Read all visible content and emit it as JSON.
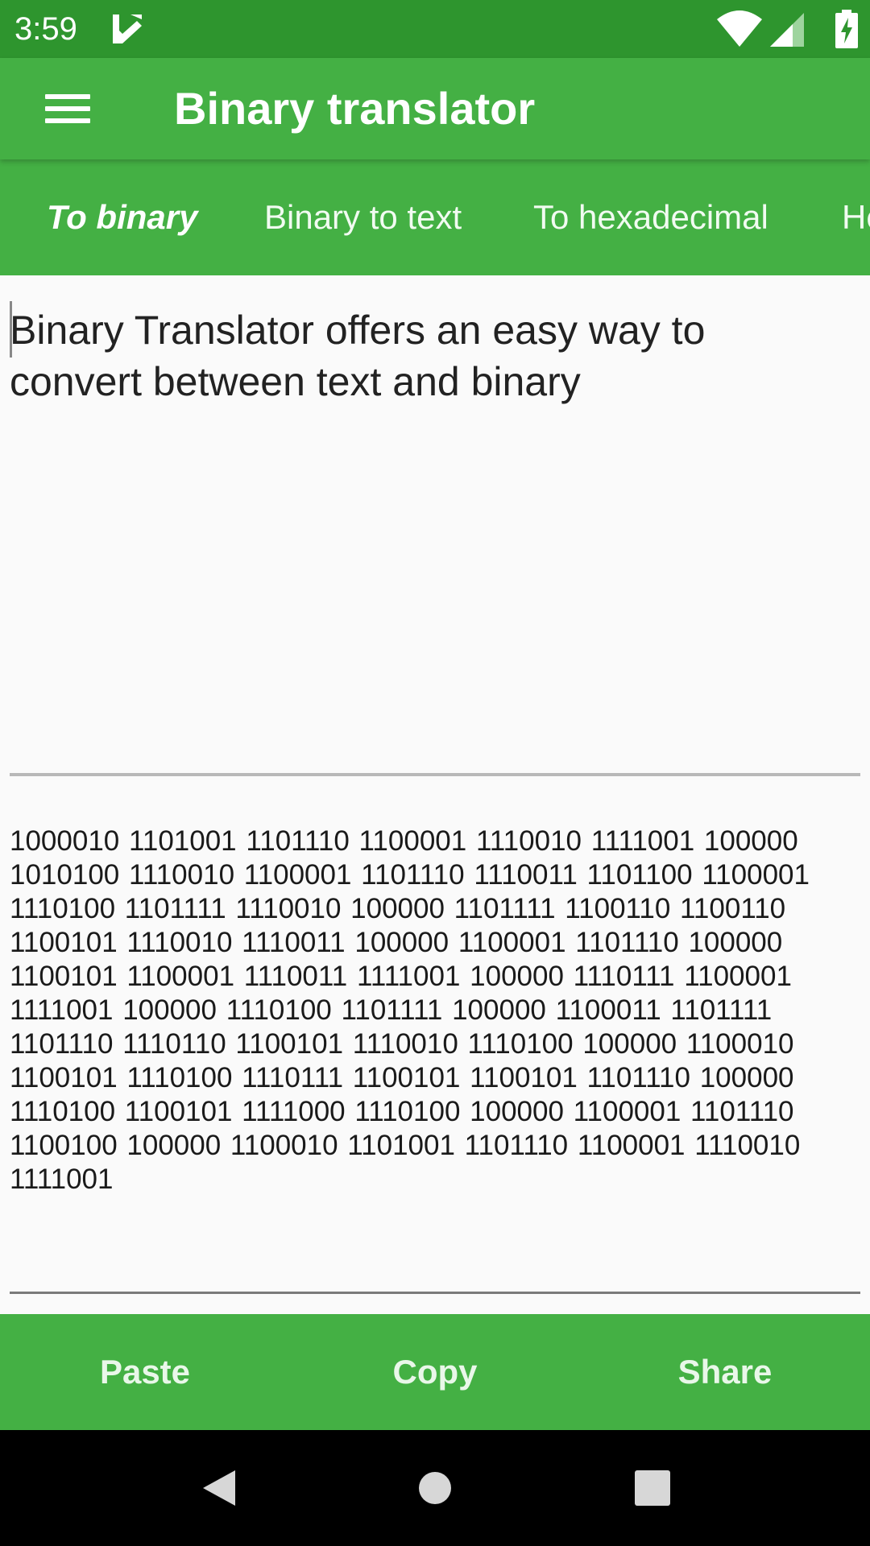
{
  "status_bar": {
    "time": "3:59",
    "icons": [
      "notification-app-icon",
      "wifi-icon",
      "signal-icon",
      "battery-charging-icon"
    ]
  },
  "app_bar": {
    "title": "Binary translator",
    "menu_icon": "hamburger-menu-icon"
  },
  "tabs": [
    {
      "label": "To binary",
      "active": true
    },
    {
      "label": "Binary to text",
      "active": false
    },
    {
      "label": "To hexadecimal",
      "active": false
    },
    {
      "label": "He",
      "active": false
    }
  ],
  "input": {
    "value": "Binary Translator offers an easy way to convert between text and binary"
  },
  "output": {
    "value": "1000010 1101001 1101110 1100001 1110010 1111001 100000 1010100 1110010 1100001 1101110 1110011 1101100 1100001 1110100 1101111 1110010 100000 1101111 1100110 1100110 1100101 1110010 1110011 100000 1100001 1101110 100000 1100101 1100001 1110011 1111001 100000 1110111 1100001 1111001 100000 1110100 1101111 100000 1100011 1101111 1101110 1110110 1100101 1110010 1110100 100000 1100010 1100101 1110100 1110111 1100101 1100101 1101110 100000 1110100 1100101 1111000 1110100 100000 1100001 1101110 1100100 100000 1100010 1101001 1101110 1100001 1110010 1111001"
  },
  "actions": {
    "paste": "Paste",
    "copy": "Copy",
    "share": "Share"
  },
  "nav_bar": {
    "icons": [
      "back-icon",
      "home-icon",
      "recents-icon"
    ]
  },
  "colors": {
    "status_bar": "#2e952e",
    "primary": "#44b044",
    "background": "#fafafa",
    "nav_bar": "#000000"
  }
}
